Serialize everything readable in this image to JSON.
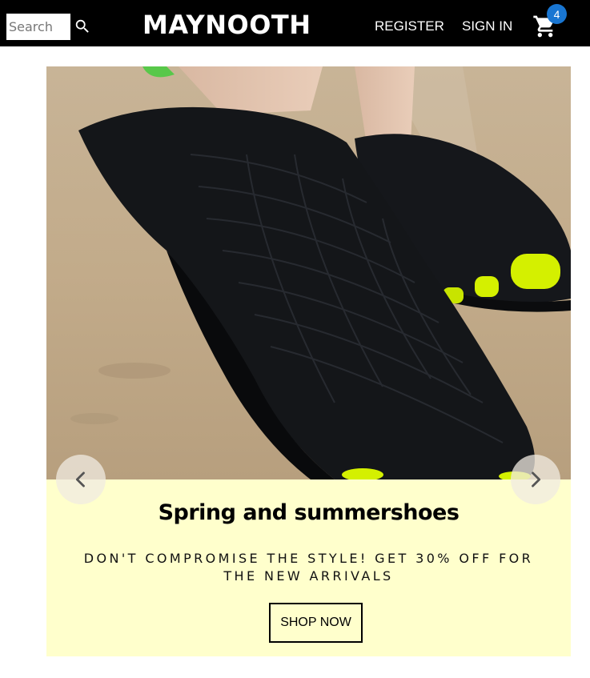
{
  "header": {
    "search": {
      "placeholder": "Search",
      "value": ""
    },
    "brand": "MAYNOOTH",
    "nav": {
      "register": "REGISTER",
      "sign_in": "SIGN IN"
    },
    "cart": {
      "count": "4"
    }
  },
  "carousel": {
    "title": "Spring and summershoes",
    "subtitle": "DON'T COMPROMISE THE STYLE! GET 30% OFF FOR THE NEW ARRIVALS",
    "button_label": "SHOP NOW"
  },
  "colors": {
    "header_bg": "#000000",
    "caption_bg": "#ffffcc",
    "badge": "#1976d2",
    "accent_sole": "#d4f000"
  },
  "icons": {
    "search": "search-icon",
    "cart": "shopping-cart-icon",
    "prev": "chevron-left-icon",
    "next": "chevron-right-icon"
  }
}
